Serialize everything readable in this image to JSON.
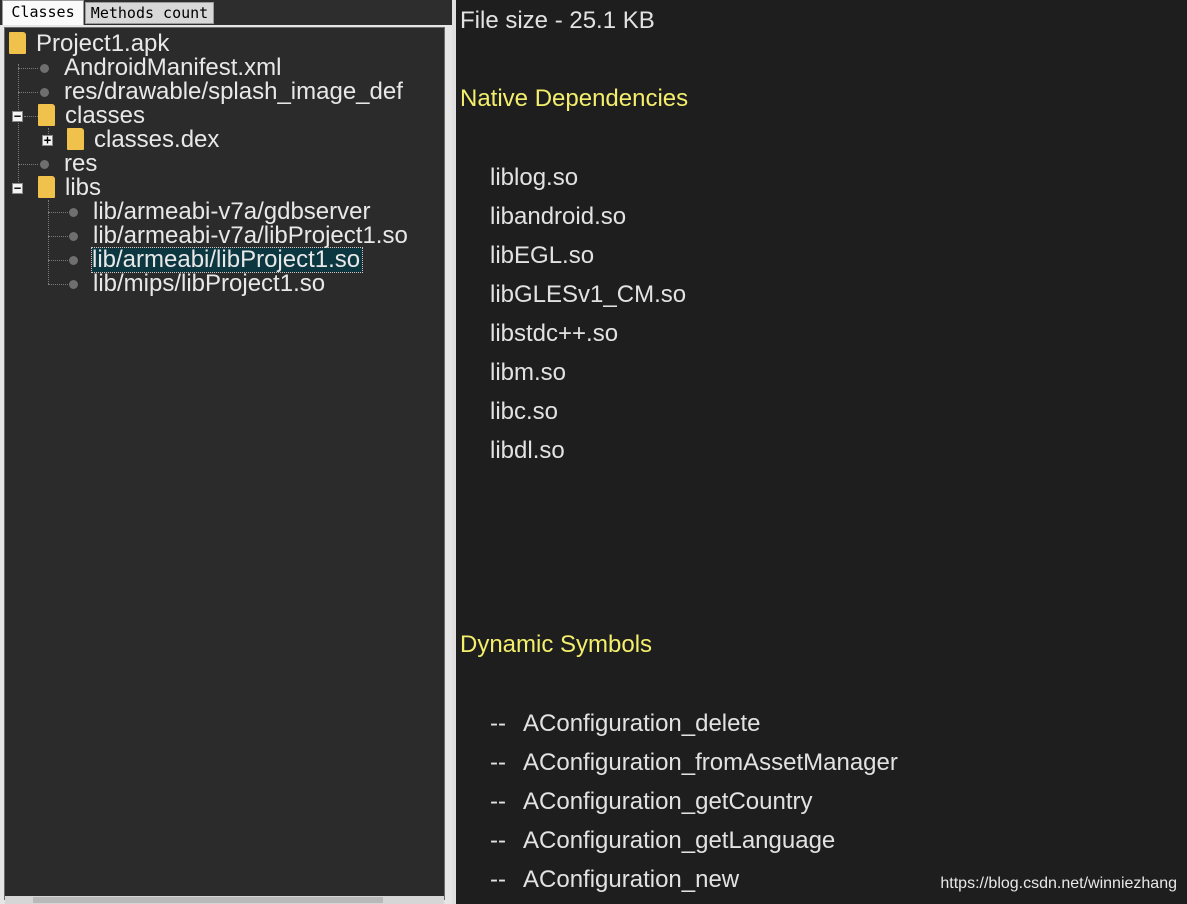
{
  "tabs": {
    "classes": "Classes",
    "methods_count": "Methods count"
  },
  "tree": {
    "root": "Project1.apk",
    "manifest": "AndroidManifest.xml",
    "splash": "res/drawable/splash_image_def",
    "classes_folder": "classes",
    "classes_dex": "classes.dex",
    "res": "res",
    "libs_folder": "libs",
    "libs": [
      "lib/armeabi-v7a/gdbserver",
      "lib/armeabi-v7a/libProject1.so",
      "lib/armeabi/libProject1.so",
      "lib/mips/libProject1.so"
    ],
    "selected": "lib/armeabi/libProject1.so",
    "expander_collapse": "−",
    "expander_expand": "+"
  },
  "details": {
    "file_size": "File size - 25.1 KB",
    "native_heading": "Native Dependencies",
    "native_deps": [
      "liblog.so",
      "libandroid.so",
      "libEGL.so",
      "libGLESv1_CM.so",
      "libstdc++.so",
      "libm.so",
      "libc.so",
      "libdl.so"
    ],
    "dynamic_heading": "Dynamic Symbols",
    "symbol_prefix": "--",
    "dynamic_symbols": [
      "AConfiguration_delete",
      "AConfiguration_fromAssetManager",
      "AConfiguration_getCountry",
      "AConfiguration_getLanguage",
      "AConfiguration_new"
    ]
  },
  "watermark": "https://blog.csdn.net/winniezhang",
  "colors": {
    "heading": "#f3ee6c",
    "text": "#e2e2e2",
    "folder": "#f0c14b",
    "selection": "#0c3740",
    "panel_bg": "#1e1e1e",
    "tree_bg": "#2b2b2b"
  }
}
